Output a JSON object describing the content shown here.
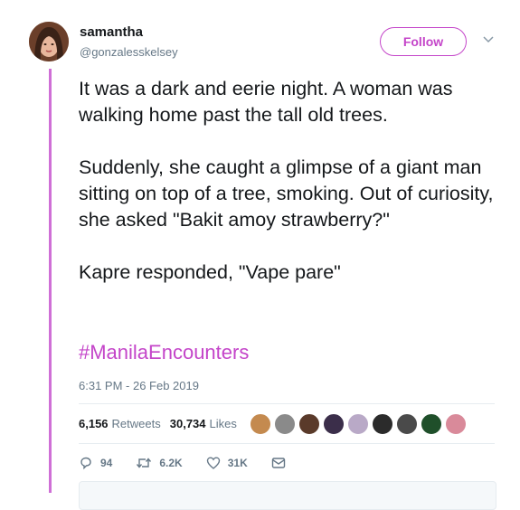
{
  "author": {
    "display_name": "samantha",
    "handle": "@gonzalesskelsey",
    "follow_label": "Follow"
  },
  "tweet": {
    "paragraphs": [
      "It was a dark and eerie night. A woman was walking home past the tall old trees.",
      "Suddenly, she caught a glimpse of a giant man sitting on top of a tree, smoking. Out of curiosity, she asked \"Bakit amoy strawberry?\"",
      "Kapre responded, \"Vape pare\""
    ],
    "hashtag": "#ManilaEncounters",
    "timestamp": "6:31 PM - 26 Feb 2019"
  },
  "stats": {
    "retweets_count": "6,156",
    "retweets_label": "Retweets",
    "likes_count": "30,734",
    "likes_label": "Likes"
  },
  "actions": {
    "reply_count": "94",
    "retweet_count": "6.2K",
    "like_count": "31K"
  },
  "colors": {
    "accent": "#c445c9",
    "thread_line": "#cf6fd6"
  }
}
